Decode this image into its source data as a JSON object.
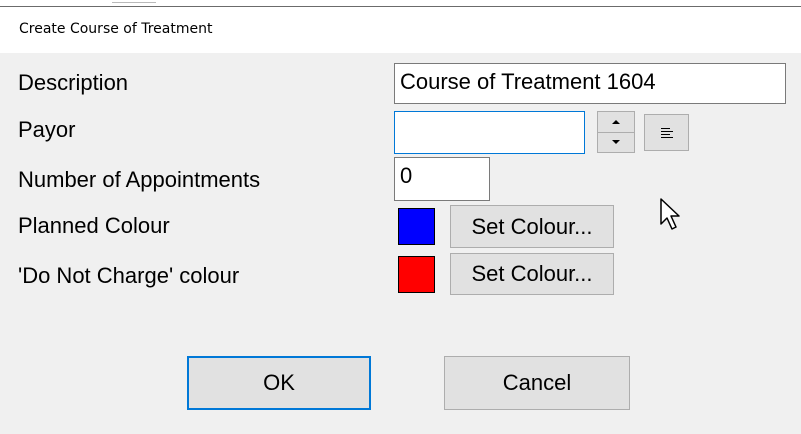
{
  "window": {
    "title": "Create Course of Treatment"
  },
  "form": {
    "description": {
      "label": "Description",
      "value": "Course of Treatment 1604"
    },
    "payor": {
      "label": "Payor",
      "value": ""
    },
    "appointments": {
      "label": "Number of Appointments",
      "value": "0"
    },
    "planned_colour": {
      "label": "Planned Colour",
      "swatch": "#0000ff",
      "button_label": "Set Colour..."
    },
    "do_not_charge_colour": {
      "label": "'Do Not Charge' colour",
      "swatch": "#ff0000",
      "button_label": "Set Colour..."
    }
  },
  "buttons": {
    "ok": "OK",
    "cancel": "Cancel"
  },
  "icons": {
    "spin_up": "arrow-up-icon",
    "spin_down": "arrow-down-icon",
    "list": "align-list-icon",
    "cursor": "mouse-pointer-icon"
  },
  "colors": {
    "dialog_background": "#f0f0f0",
    "focus_accent": "#0078d7",
    "button_face": "#e1e1e1"
  }
}
